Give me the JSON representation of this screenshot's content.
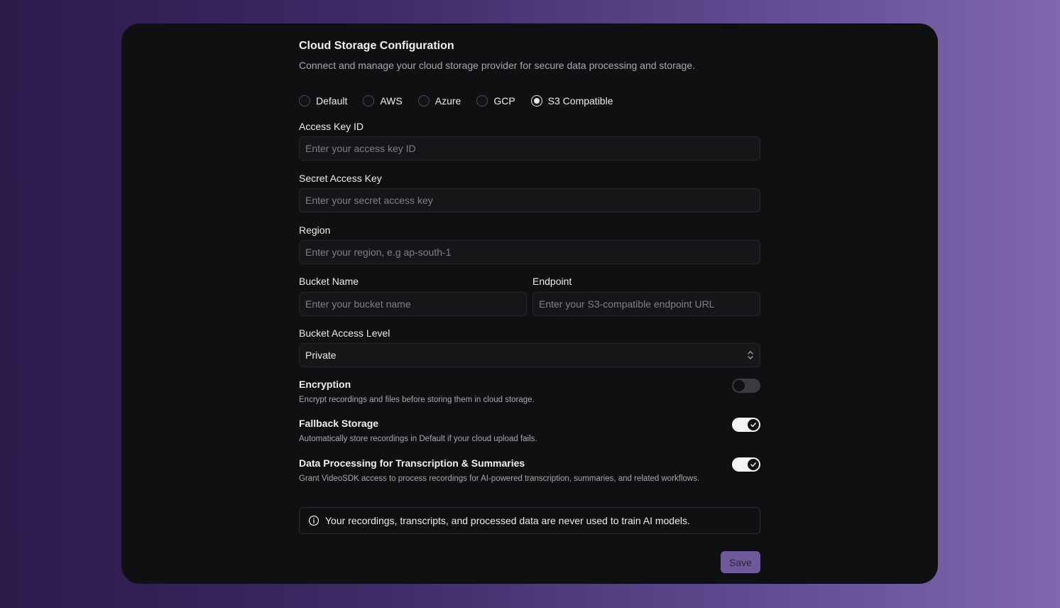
{
  "header": {
    "title": "Cloud Storage Configuration",
    "subtitle": "Connect and manage your cloud storage provider for secure data processing and storage."
  },
  "providers": {
    "options": [
      "Default",
      "AWS",
      "Azure",
      "GCP",
      "S3 Compatible"
    ],
    "selected": "S3 Compatible"
  },
  "fields": {
    "access_key_id": {
      "label": "Access Key ID",
      "placeholder": "Enter your access key ID",
      "value": ""
    },
    "secret_access_key": {
      "label": "Secret Access Key",
      "placeholder": "Enter your secret access key",
      "value": ""
    },
    "region": {
      "label": "Region",
      "placeholder": "Enter your region, e.g ap-south-1",
      "value": ""
    },
    "bucket_name": {
      "label": "Bucket Name",
      "placeholder": "Enter your bucket name",
      "value": ""
    },
    "endpoint": {
      "label": "Endpoint",
      "placeholder": "Enter your S3-compatible endpoint URL",
      "value": ""
    },
    "bucket_access_level": {
      "label": "Bucket Access Level",
      "value": "Private"
    }
  },
  "settings": {
    "encryption": {
      "title": "Encryption",
      "description": "Encrypt recordings and files before storing them in cloud storage.",
      "enabled": false
    },
    "fallback_storage": {
      "title": "Fallback Storage",
      "description": "Automatically store recordings in Default if your cloud upload fails.",
      "enabled": true
    },
    "data_processing": {
      "title": "Data Processing for Transcription & Summaries",
      "description": "Grant VideoSDK access to process recordings for AI-powered transcription, summaries, and related workflows.",
      "enabled": true
    }
  },
  "notice": {
    "text": "Your recordings, transcripts, and processed data are never used to train AI models.",
    "icon": "info-icon"
  },
  "actions": {
    "save_label": "Save"
  },
  "colors": {
    "accent": "#6e5a9a",
    "card_bg": "#0f1011"
  }
}
